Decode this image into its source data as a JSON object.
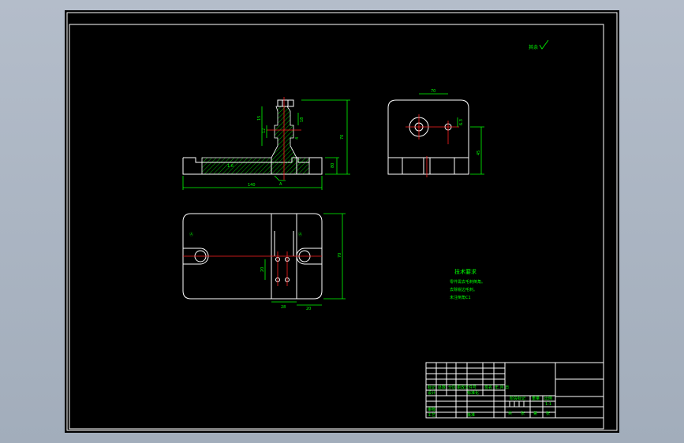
{
  "drawing": {
    "roughness_note": "其余",
    "tech_requirements": {
      "title": "技术要求",
      "lines": [
        "零件需去毛刺倒角。",
        "去除锐边毛刺。",
        "未注倒角C1"
      ]
    },
    "front_view": {
      "dims": [
        "140",
        "80",
        "70",
        "15",
        "12",
        "4",
        "18",
        "1.6",
        "20"
      ],
      "labels": [
        "A"
      ]
    },
    "side_view": {
      "dims": [
        "70",
        "45",
        "6.3"
      ]
    },
    "top_view": {
      "dims": [
        "70",
        "20",
        "28",
        "20"
      ]
    },
    "title_block": {
      "labels": [
        "标记",
        "处数",
        "分区",
        "更改文件号",
        "签名",
        "年.月.日",
        "设计",
        "标准化",
        "审核",
        "工艺",
        "批准",
        "阶段标记",
        "重量",
        "比例",
        "共",
        "张",
        "第",
        "张"
      ],
      "scale": "1:1"
    }
  },
  "colors": {
    "background": "#000000",
    "outline": "#ffffff",
    "dimension": "#00ff00",
    "centerline": "#ff2020",
    "viewport": "#a7b1bf"
  }
}
